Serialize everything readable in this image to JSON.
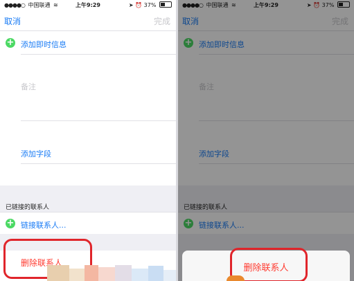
{
  "status_bar": {
    "signal": "●●●●○",
    "carrier": "中国联通",
    "wifi": "≋",
    "time": "上午9:29",
    "battery": "37%",
    "icons": [
      "location-arrow-icon",
      "alarm-icon",
      "battery-icon",
      "wifi-icon"
    ]
  },
  "nav": {
    "cancel_label": "取消",
    "done_label": "完成"
  },
  "contact_form": {
    "add_instant_message": "添加即时信息",
    "notes_label": "备注",
    "add_field": "添加字段",
    "linked_contacts_header": "已链接的联系人",
    "link_contact": "链接联系人...",
    "delete_contact": "删除联系人"
  },
  "action_sheet": {
    "delete_contact": "删除联系人"
  },
  "colors": {
    "accent": "#1a7cf5",
    "destructive": "#ff3b30",
    "add_icon": "#4cd964",
    "annotation": "#e0252b",
    "grouped_background": "#efeff4"
  }
}
